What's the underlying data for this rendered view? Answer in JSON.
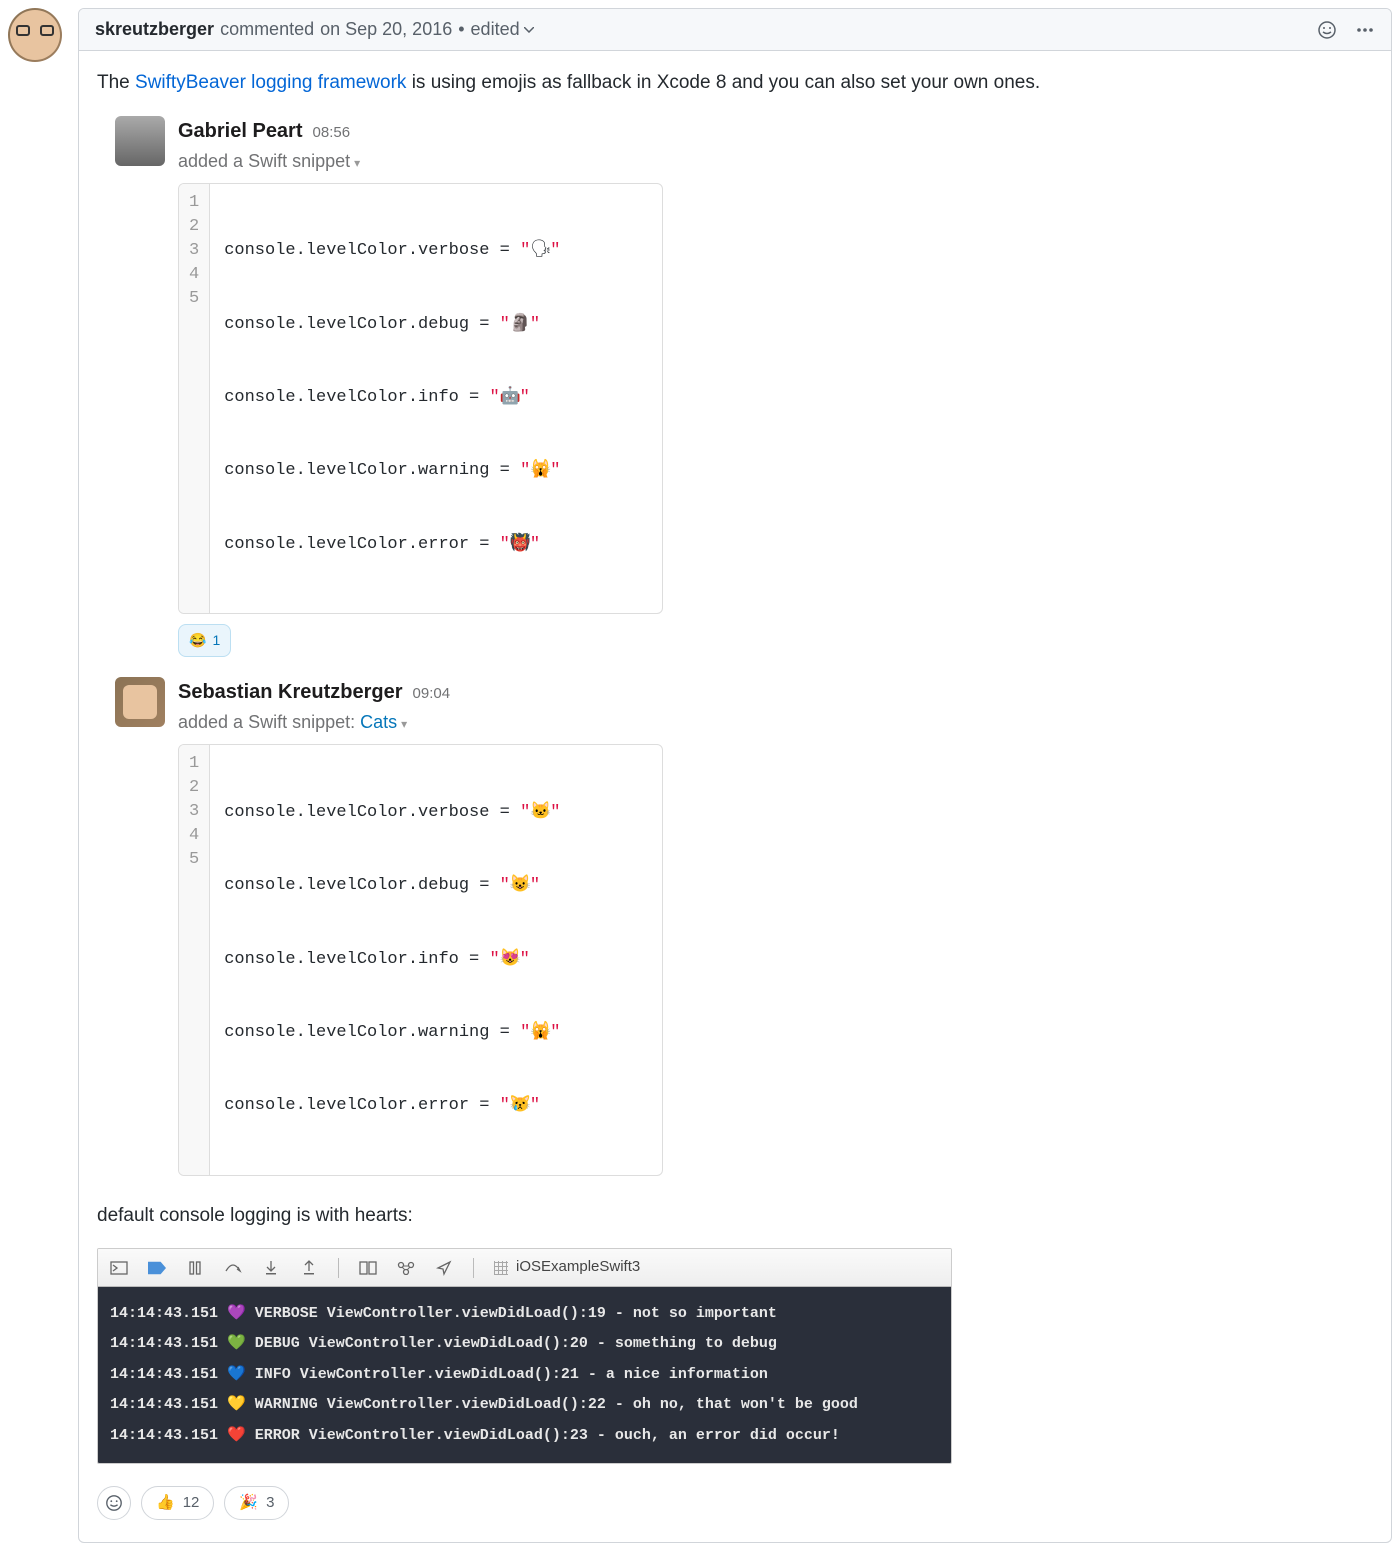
{
  "comment": {
    "author": "skreutzberger",
    "action": "commented",
    "date": "on Sep 20, 2016",
    "bullet": "•",
    "edited": "edited",
    "body_prefix": "The ",
    "link_text": "SwiftyBeaver logging framework",
    "body_suffix": " is using emojis as fallback in Xcode 8 and you can also set your own ones."
  },
  "slack1": {
    "name": "Gabriel Peart",
    "time": "08:56",
    "sub": "added a Swift snippet",
    "lines": [
      {
        "n": "1",
        "code": "console.levelColor.verbose = ",
        "q": "\"",
        "emoji": "🗣",
        "q2": "\""
      },
      {
        "n": "2",
        "code": "console.levelColor.debug = ",
        "q": "\"",
        "emoji": "🗿",
        "q2": "\""
      },
      {
        "n": "3",
        "code": "console.levelColor.info = ",
        "q": "\"",
        "emoji": "🤖",
        "q2": "\""
      },
      {
        "n": "4",
        "code": "console.levelColor.warning = ",
        "q": "\"",
        "emoji": "🙀",
        "q2": "\""
      },
      {
        "n": "5",
        "code": "console.levelColor.error = ",
        "q": "\"",
        "emoji": "👹",
        "q2": "\""
      }
    ],
    "reaction_emoji": "😂",
    "reaction_count": "1"
  },
  "slack2": {
    "name": "Sebastian Kreutzberger",
    "time": "09:04",
    "sub_prefix": "added a Swift snippet: ",
    "sub_link": "Cats",
    "lines": [
      {
        "n": "1",
        "code": "console.levelColor.verbose = ",
        "q": "\"",
        "emoji": "🐱",
        "q2": "\""
      },
      {
        "n": "2",
        "code": "console.levelColor.debug = ",
        "q": "\"",
        "emoji": "😺",
        "q2": "\""
      },
      {
        "n": "3",
        "code": "console.levelColor.info = ",
        "q": "\"",
        "emoji": "😻",
        "q2": "\""
      },
      {
        "n": "4",
        "code": "console.levelColor.warning = ",
        "q": "\"",
        "emoji": "🙀",
        "q2": "\""
      },
      {
        "n": "5",
        "code": "console.levelColor.error = ",
        "q": "\"",
        "emoji": "😿",
        "q2": "\""
      }
    ]
  },
  "section2": "default console logging is with hearts:",
  "xcode": {
    "target": "iOSExampleSwift3",
    "rows": [
      {
        "ts": "14:14:43.151",
        "heart": "💜",
        "level": "VERBOSE",
        "loc": "ViewController.viewDidLoad():19",
        "msg": "not so important"
      },
      {
        "ts": "14:14:43.151",
        "heart": "💚",
        "level": "DEBUG",
        "loc": "ViewController.viewDidLoad():20",
        "msg": "something to debug"
      },
      {
        "ts": "14:14:43.151",
        "heart": "💙",
        "level": "INFO",
        "loc": "ViewController.viewDidLoad():21",
        "msg": "a nice information"
      },
      {
        "ts": "14:14:43.151",
        "heart": "💛",
        "level": "WARNING",
        "loc": "ViewController.viewDidLoad():22",
        "msg": "oh no, that won't be good"
      },
      {
        "ts": "14:14:43.151",
        "heart": "❤️",
        "level": "ERROR",
        "loc": "ViewController.viewDidLoad():23",
        "msg": "ouch, an error did occur!"
      }
    ]
  },
  "reactions": [
    {
      "emoji": "👍",
      "count": "12"
    },
    {
      "emoji": "🎉",
      "count": "3"
    }
  ]
}
